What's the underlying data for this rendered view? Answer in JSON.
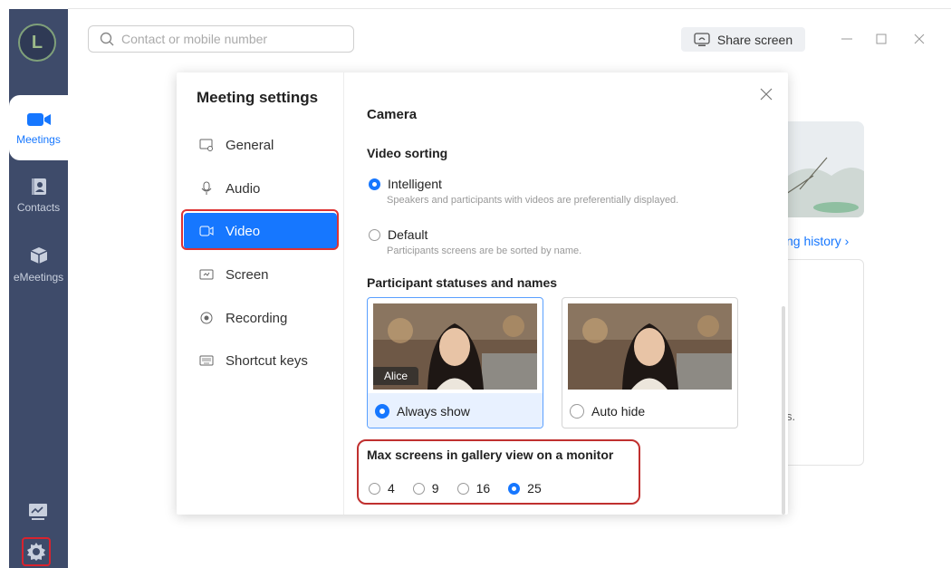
{
  "app": {
    "logo_letter": "L",
    "rail": {
      "meetings": "Meetings",
      "contacts": "Contacts",
      "emeetings": "eMeetings"
    }
  },
  "topbar": {
    "search_placeholder": "Contact or mobile number",
    "share_label": "Share screen"
  },
  "background": {
    "history_link": "ng history ›",
    "snippet": "s."
  },
  "dialog": {
    "title": "Meeting settings",
    "nav": [
      {
        "label": "General",
        "icon": "general-icon"
      },
      {
        "label": "Audio",
        "icon": "mic-icon"
      },
      {
        "label": "Video",
        "icon": "video-icon",
        "active": true
      },
      {
        "label": "Screen",
        "icon": "screen-icon"
      },
      {
        "label": "Recording",
        "icon": "record-icon"
      },
      {
        "label": "Shortcut keys",
        "icon": "keyboard-icon"
      }
    ],
    "camera_heading": "Camera",
    "video_sorting": {
      "heading": "Video sorting",
      "options": [
        {
          "label": "Intelligent",
          "desc": "Speakers and participants with videos are preferentially displayed.",
          "selected": true
        },
        {
          "label": "Default",
          "desc": "Participants screens are be sorted by name.",
          "selected": false
        }
      ]
    },
    "participant": {
      "heading": "Participant statuses and names",
      "options": [
        {
          "label": "Always show",
          "name_tag": "Alice",
          "selected": true
        },
        {
          "label": "Auto hide",
          "selected": false
        }
      ]
    },
    "gallery": {
      "heading": "Max screens in gallery view on a monitor",
      "options": [
        {
          "label": "4",
          "selected": false
        },
        {
          "label": "9",
          "selected": false
        },
        {
          "label": "16",
          "selected": false
        },
        {
          "label": "25",
          "selected": true
        }
      ]
    }
  },
  "colors": {
    "accent": "#1677ff",
    "rail": "#3e4b6a",
    "highlight": "#d33333"
  }
}
